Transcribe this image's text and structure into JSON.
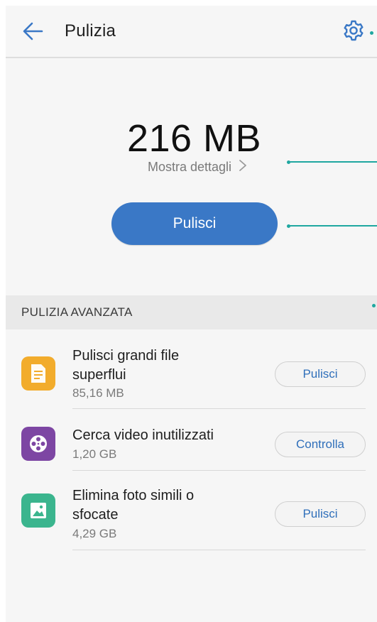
{
  "header": {
    "title": "Pulizia",
    "back_icon": "arrow-left-icon",
    "settings_icon": "gear-icon"
  },
  "summary": {
    "size": "216 MB",
    "details_label": "Mostra dettagli",
    "clean_button": "Pulisci"
  },
  "section": {
    "title": "PULIZIA AVANZATA",
    "items": [
      {
        "title_line1": "Pulisci grandi file",
        "title_line2": "superflui",
        "size": "85,16 MB",
        "button": "Pulisci",
        "icon": "document-icon",
        "icon_color": "#f2ac2c"
      },
      {
        "title_line1": "Cerca video inutilizzati",
        "title_line2": "",
        "size": "1,20 GB",
        "button": "Controlla",
        "icon": "film-reel-icon",
        "icon_color": "#7d46a3"
      },
      {
        "title_line1": "Elimina foto simili o",
        "title_line2": "sfocate",
        "size": "4,29 GB",
        "button": "Pulisci",
        "icon": "photo-icon",
        "icon_color": "#3bb58e"
      }
    ]
  },
  "colors": {
    "accent": "#3a78c6",
    "annotation": "#1fa7a0"
  }
}
